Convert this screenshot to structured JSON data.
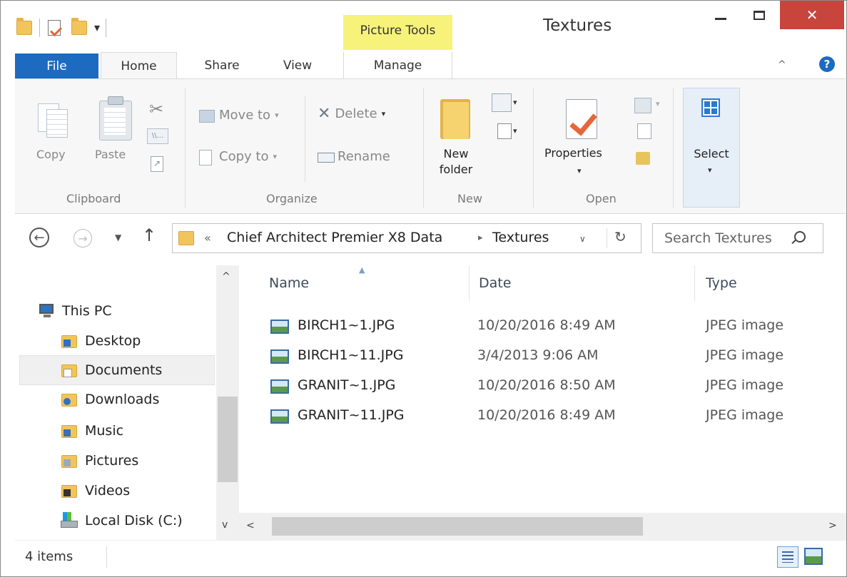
{
  "window": {
    "title": "Textures",
    "context_tab_group": "Picture Tools",
    "close_glyph": "✕"
  },
  "ribbon_tabs": {
    "file": "File",
    "home": "Home",
    "share": "Share",
    "view": "View",
    "manage": "Manage"
  },
  "ribbon": {
    "clipboard": {
      "label": "Clipboard",
      "copy": "Copy",
      "paste": "Paste"
    },
    "organize": {
      "label": "Organize",
      "move_to": "Move to",
      "copy_to": "Copy to",
      "delete": "Delete",
      "rename": "Rename"
    },
    "new": {
      "label": "New",
      "new_folder_line1": "New",
      "new_folder_line2": "folder"
    },
    "open": {
      "label": "Open",
      "properties": "Properties"
    },
    "select": {
      "label": "Select"
    }
  },
  "address": {
    "prefix": "«",
    "crumbs": [
      "Chief Architect Premier X8 Data",
      "Textures"
    ],
    "separator": "▸"
  },
  "search": {
    "placeholder": "Search Textures"
  },
  "nav_tree": [
    {
      "label": "This PC",
      "icon": "computer-icon"
    },
    {
      "label": "Desktop",
      "icon": "desktop-folder-icon"
    },
    {
      "label": "Documents",
      "icon": "documents-folder-icon",
      "selected": true
    },
    {
      "label": "Downloads",
      "icon": "downloads-folder-icon"
    },
    {
      "label": "Music",
      "icon": "music-folder-icon"
    },
    {
      "label": "Pictures",
      "icon": "pictures-folder-icon"
    },
    {
      "label": "Videos",
      "icon": "videos-folder-icon"
    },
    {
      "label": "Local Disk (C:)",
      "icon": "local-disk-icon"
    }
  ],
  "file_list": {
    "columns": [
      "Name",
      "Date",
      "Type"
    ],
    "sorted_by": "Name",
    "rows": [
      {
        "name": "BIRCH1~1.JPG",
        "date": "10/20/2016 8:49 AM",
        "type": "JPEG image"
      },
      {
        "name": "BIRCH1~11.JPG",
        "date": "3/4/2013 9:06 AM",
        "type": "JPEG image"
      },
      {
        "name": "GRANIT~1.JPG",
        "date": "10/20/2016 8:50 AM",
        "type": "JPEG image"
      },
      {
        "name": "GRANIT~11.JPG",
        "date": "10/20/2016 8:49 AM",
        "type": "JPEG image"
      }
    ]
  },
  "status": {
    "item_count": "4 items"
  },
  "colors": {
    "file_tab": "#1c6bc0",
    "context_tab": "#f7f27a",
    "close_button": "#c8453d",
    "accent": "#2a7ad1"
  }
}
